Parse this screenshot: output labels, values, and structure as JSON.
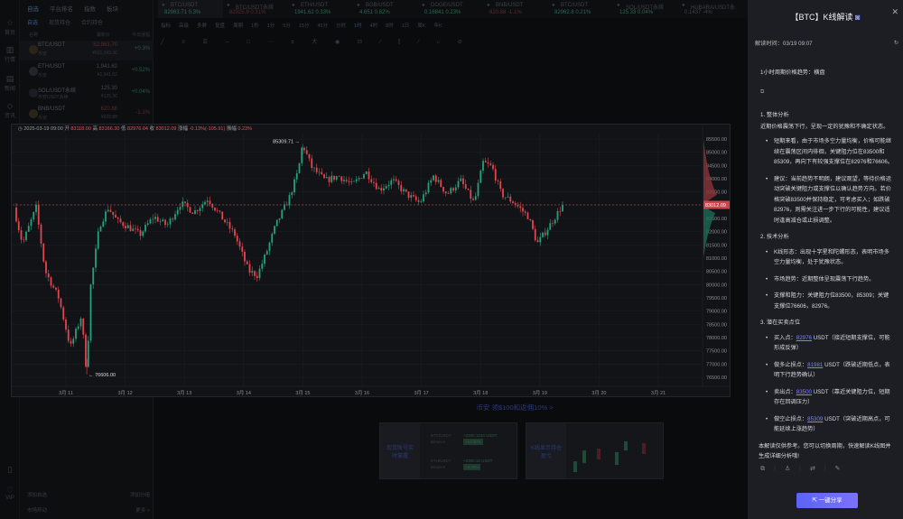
{
  "sidebar": {
    "items": [
      {
        "label": "首页"
      },
      {
        "label": "行情"
      },
      {
        "label": "新闻"
      },
      {
        "label": "资讯"
      },
      {
        "label": "VIP"
      }
    ]
  },
  "watchlist": {
    "tabs": [
      "自选",
      "平台排名",
      "指数",
      "板块"
    ],
    "subtabs": [
      "自选",
      "现货持仓",
      "合约持仓"
    ],
    "headers": [
      "名称",
      "最新价",
      "今日涨幅"
    ],
    "rows": [
      {
        "name": "BTC/USDT",
        "sub": "币安",
        "price": "82,963.70",
        "price2": "¥601,043.30",
        "change": "+0.3%",
        "color": "#e0555c"
      },
      {
        "name": "ETH/USDT",
        "sub": "币安",
        "price": "1,941.62",
        "price2": "¥1,941.62",
        "change": "+0.52%",
        "color": "#3a3c42"
      },
      {
        "name": "SOL/USDT永续",
        "sub": "币安USDT永续",
        "price": "125.30",
        "price2": "¥125.30",
        "change": "+0.04%",
        "color": "#3a3c42"
      },
      {
        "name": "BNB/USDT",
        "sub": "币安",
        "price": "620.88",
        "price2": "¥620.88",
        "change": "-1.1%",
        "color": "#5a2a2c"
      }
    ],
    "add_watch": "添加自选",
    "add_group": "添加分组",
    "market_moves": "市场异动",
    "more": "更多 >"
  },
  "tickers": [
    {
      "name": "BTC/USDT",
      "value": "82963.71 0.3%",
      "color": "#2a6a4e"
    },
    {
      "name": "BTC/USDT永续",
      "value": "82925.9 0.31%",
      "color": "#5a2a2c"
    },
    {
      "name": "ETH/USDT",
      "value": "1941.62 0.33%",
      "color": "#2a6a4e"
    },
    {
      "name": "BGB/USDT",
      "value": "4.651 0.82%",
      "color": "#2a6a4e"
    },
    {
      "name": "DOGE/USDT",
      "value": "0.16841 0.23%",
      "color": "#2a6a4e"
    },
    {
      "name": "BNB/USDT",
      "value": "620.88 -1.1%",
      "color": "#5a2a2c"
    },
    {
      "name": "BTC/USDT",
      "value": "82962.8 0.21%",
      "color": "#2a6a4e"
    },
    {
      "name": "SOL/USDT永续",
      "value": "125.33 0.04%",
      "color": "#2a6a4e"
    },
    {
      "name": "HUBARA/USDT永",
      "value": "0.1437 -4%",
      "color": "#3e4045"
    }
  ],
  "toolbar": {
    "items": [
      "指标",
      "高级",
      "多屏",
      "复盘",
      "周期"
    ],
    "periods": [
      "1秒",
      "1分",
      "5分",
      "15分",
      "45分",
      "分时",
      "1时",
      "4时",
      "8时",
      "1日",
      "周K",
      "年K"
    ],
    "active_period": "1时"
  },
  "ohlc": {
    "time": "2025-03-19 09:00",
    "open_label": "开",
    "open": "83118.00",
    "high_label": "高",
    "high": "83166.30",
    "low_label": "低",
    "low": "82976.04",
    "close_label": "收",
    "close": "83012.09",
    "chg_label": "涨幅",
    "chg": "-0.13%(-105.91)",
    "amp_label": "振幅",
    "amp": "0.23%"
  },
  "chart_data": {
    "type": "candlestick",
    "interval": "1h",
    "ylim": [
      76300,
      85700
    ],
    "yticks": [
      85500,
      85000,
      84500,
      84000,
      83500,
      83000,
      82500,
      82000,
      81500,
      81000,
      80500,
      80000,
      79500,
      79000,
      78500,
      78000,
      77500,
      77000,
      76500
    ],
    "ytick_labels": [
      "85500.00",
      "85000.00",
      "84500.00",
      "84000.00",
      "83500.00",
      "83000.00",
      "82500.00",
      "82000.00",
      "81500.00",
      "81000.00",
      "80500.00",
      "80000.00",
      "79500.00",
      "79000.00",
      "78500.00",
      "78000.00",
      "77500.00",
      "77000.00",
      "76500.00"
    ],
    "xtick_labels": [
      "3月 11",
      "3月 12",
      "3月 13",
      "3月 14",
      "3月 15",
      "3月 16",
      "3月 17",
      "3月 18",
      "3月 19",
      "3月 20",
      "3月 21"
    ],
    "hours_since": "3月 10 00:00",
    "path": [
      [
        3,
        82908
      ],
      [
        6.5,
        81544
      ],
      [
        12,
        82908
      ],
      [
        15.6,
        80521
      ],
      [
        21.1,
        79498
      ],
      [
        25.8,
        77623
      ],
      [
        30.2,
        78816
      ],
      [
        32.4,
        76606
      ],
      [
        33.8,
        79840
      ],
      [
        37.5,
        82226
      ],
      [
        41.1,
        82908
      ],
      [
        44.7,
        82397
      ],
      [
        48.4,
        82226
      ],
      [
        53.8,
        81885
      ],
      [
        59.3,
        82567
      ],
      [
        64.7,
        82226
      ],
      [
        70.2,
        83079
      ],
      [
        75.6,
        82738
      ],
      [
        81.1,
        83249
      ],
      [
        86.5,
        82567
      ],
      [
        92,
        81885
      ],
      [
        97.5,
        80521
      ],
      [
        101.1,
        80351
      ],
      [
        104.7,
        81204
      ],
      [
        108.4,
        82226
      ],
      [
        113.8,
        83249
      ],
      [
        117.5,
        84272
      ],
      [
        119.3,
        85309.71
      ],
      [
        122.9,
        84443
      ],
      [
        128.4,
        83931
      ],
      [
        133.8,
        84102
      ],
      [
        139.3,
        83761
      ],
      [
        144.7,
        84272
      ],
      [
        150.2,
        83590
      ],
      [
        155.6,
        83931
      ],
      [
        161.1,
        83420
      ],
      [
        166.5,
        83079
      ],
      [
        172,
        84102
      ],
      [
        177.5,
        83420
      ],
      [
        182.9,
        83931
      ],
      [
        188.4,
        83079
      ],
      [
        192,
        84613
      ],
      [
        195.6,
        84443
      ],
      [
        199.3,
        83420
      ],
      [
        204.7,
        83079
      ],
      [
        210.2,
        82567
      ],
      [
        213.8,
        81544
      ],
      [
        217.5,
        82056
      ],
      [
        221.1,
        82567
      ],
      [
        224,
        83012.09
      ]
    ],
    "high_label": "85309.71",
    "low_label": "76606.00",
    "last_price": 83012.09,
    "last_label": "83012.09",
    "up_color": "#26a17b",
    "down_color": "#e0464f"
  },
  "promo": {
    "text": "币安 领$100和返佣10% >",
    "card1_title": "现货账号实时掌握",
    "card1_rows": [
      {
        "pair": "BTC/USDT",
        "ex": "Binance",
        "val": "+2300.1234 USDT",
        "pct": "+23.00%"
      },
      {
        "pair": "ETH/USDT",
        "ex": "Binance",
        "val": "+2300.12 USDT",
        "pct": "+8.00%"
      }
    ],
    "card2_title": "K线显示持仓盈亏"
  },
  "panel": {
    "title": "【BTC】K线解读",
    "time": "解读时间：03/19 09:07",
    "trend": "1小时周期价格趋势：横盘",
    "s1": "1. 整体分析",
    "s1_p": "近期价格震荡下行，呈现一定的犹豫和不确定状态。",
    "s1_b1": "短期来看，由于市场多空力量均衡，价格可能继续在震荡区间内徘徊，关键阻力位在83500和85309，再向下有较强支撑位在82976和76606。",
    "s1_b2": "建议：当前趋势不明朗，建议观望，等待价格运动突破关键阻力或支撑位以确认趋势方向。若价格突破83500并保持稳定，可考虑买入；如跌破82976，则需关注进一步下行的可能性，建议适时逢高减仓或止损调整。",
    "s2": "2. 技术分析",
    "s2_b1": "K线形态：出现十字星和陀螺形态，表明市场多空力量均衡，处于犹豫状态。",
    "s2_b2": "市场趋势：近期整体呈现震荡下行趋势。",
    "s2_b3": "支撑和阻力：关键阻力位83500，85309；关键支撑位76606，82976。",
    "s3": "3. 潜在买卖点位",
    "points": [
      {
        "label": "买入点：",
        "value": "82976",
        "unit": " USDT",
        "note": "（接近短期支撑位，可能形成反弹）"
      },
      {
        "label": "做多止损点：",
        "value": "81981",
        "unit": " USDT",
        "note": "（跌破近期低点，表明下行趋势确认）"
      },
      {
        "label": "卖出点：",
        "value": "83500",
        "unit": " USDT",
        "note": "（靠近关键阻力位，短期存在回调压力）"
      },
      {
        "label": "做空止损点：",
        "value": "85309",
        "unit": " USDT",
        "note": "（突破近期高点，可能延续上涨趋势）"
      }
    ],
    "footer": "本解读仅供参考。您可以切换周期，快速解读K线图并生成详细分析哦!",
    "share": "一键分享"
  }
}
